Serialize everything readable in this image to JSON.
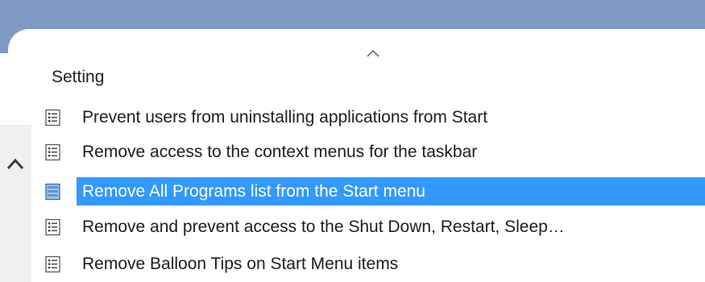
{
  "colors": {
    "top_band": "#7e9ac4",
    "selection": "#3399ff",
    "text": "#1e1e1e",
    "selected_text": "#ffffff",
    "left_strip": "#f0f0f0"
  },
  "header": {
    "label": "Setting",
    "sort_icon": "sort-ascending-chevron-icon"
  },
  "scroll": {
    "up_icon": "chevron-up-icon"
  },
  "rows": [
    {
      "label": "Prevent users from uninstalling applications from Start",
      "icon": "policy-setting-icon",
      "selected": false
    },
    {
      "label": "Remove access to the context menus for the taskbar",
      "icon": "policy-setting-icon",
      "selected": false
    },
    {
      "label": "Remove All Programs list from the Start menu",
      "icon": "policy-setting-icon",
      "selected": true
    },
    {
      "label": "Remove and prevent access to the Shut Down, Restart, Sleep…",
      "icon": "policy-setting-icon",
      "selected": false
    },
    {
      "label": "Remove Balloon Tips on Start Menu items",
      "icon": "policy-setting-icon",
      "selected": false
    }
  ]
}
